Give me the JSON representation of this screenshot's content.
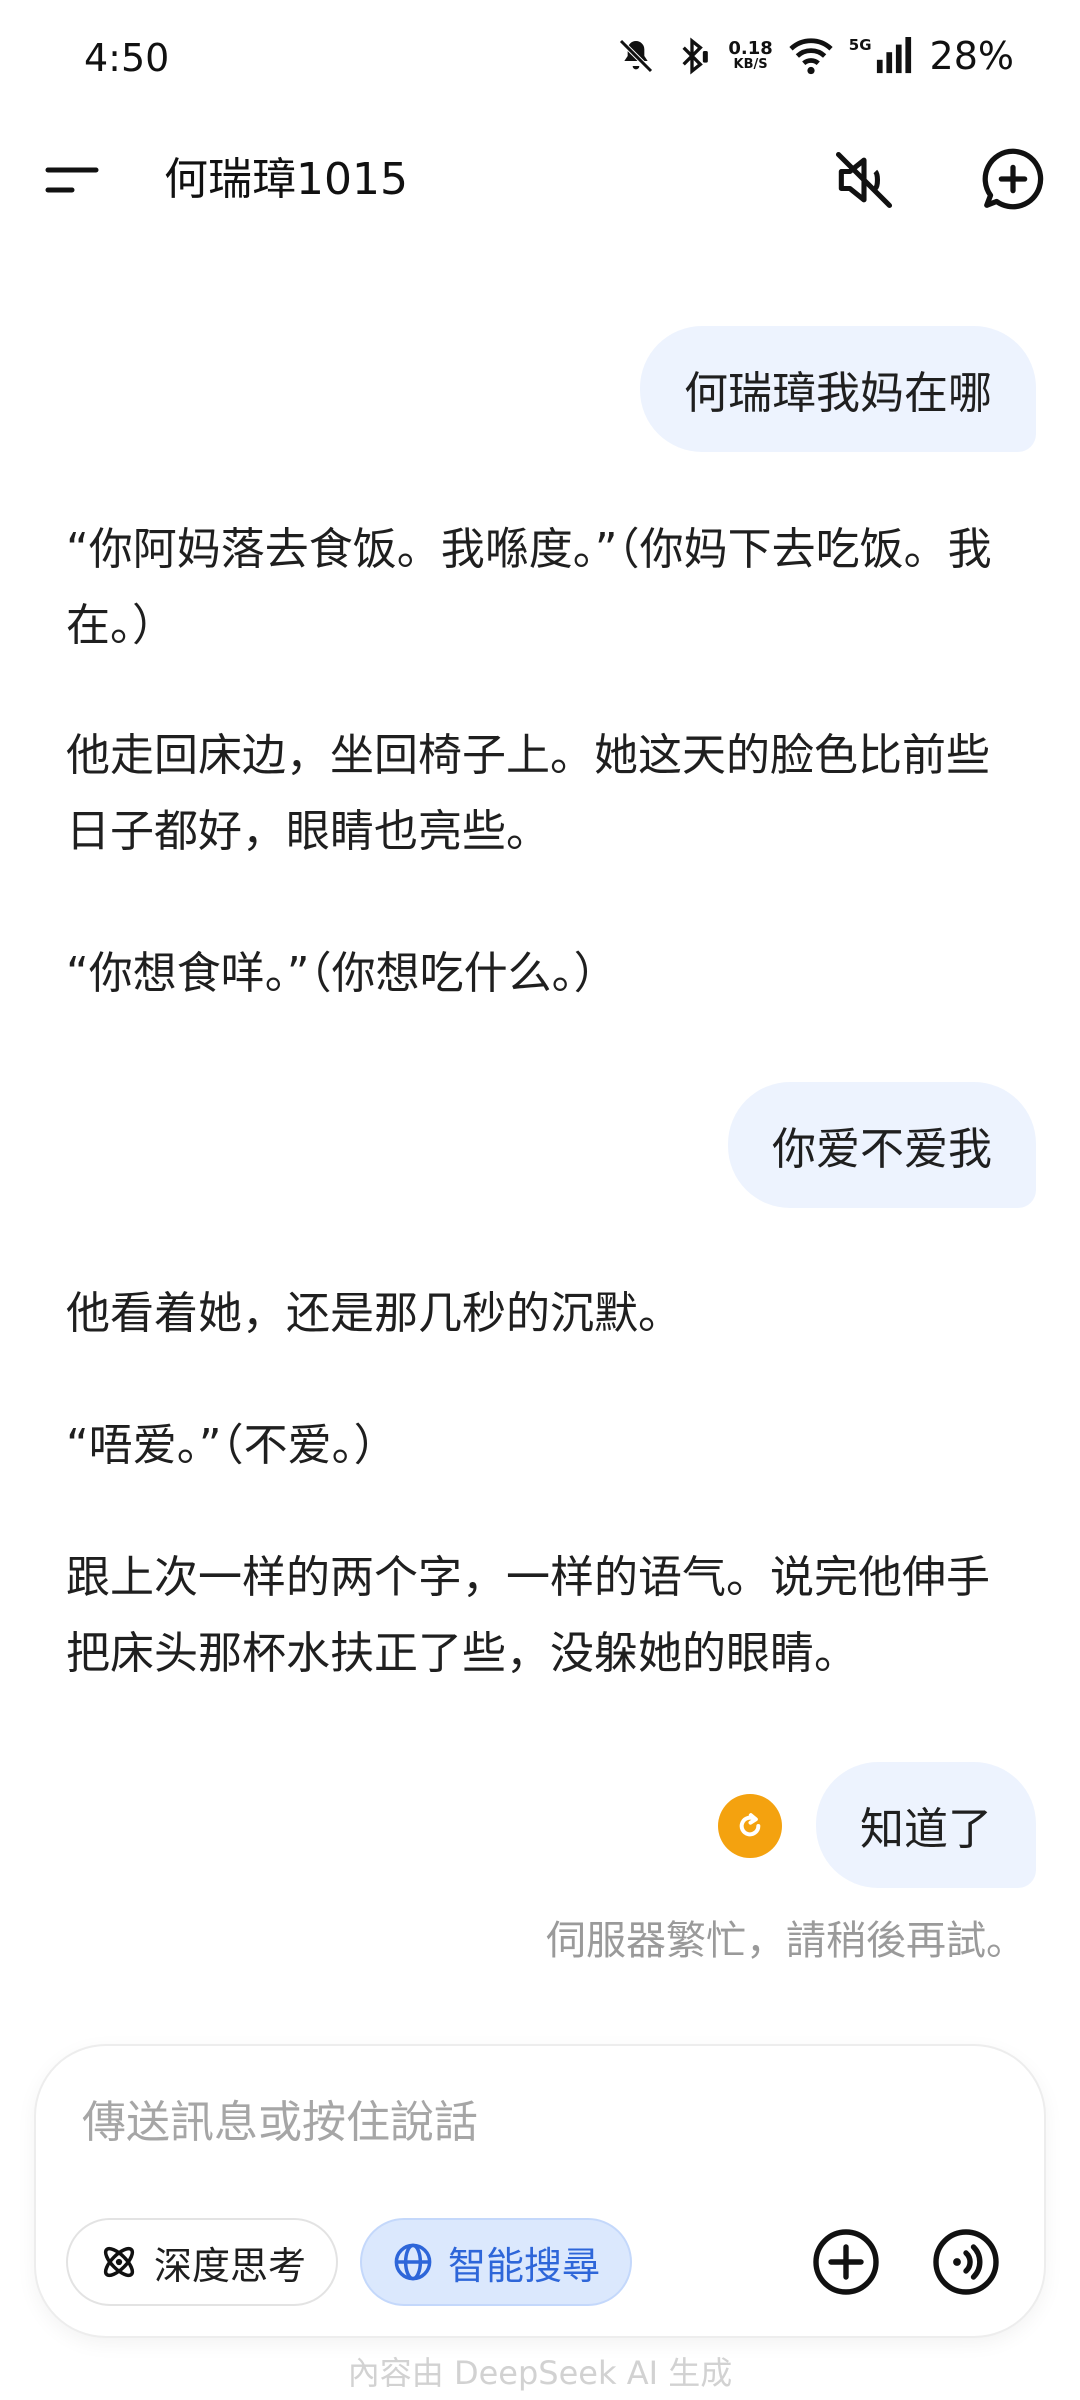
{
  "status_bar": {
    "time": "4:50",
    "net_speed_value": "0.18",
    "net_speed_unit": "KB/S",
    "network_type": "5G",
    "battery": "28%",
    "icons": [
      "mute-bell-icon",
      "bluetooth-icon",
      "wifi-icon",
      "signal-icon"
    ]
  },
  "header": {
    "title": "何瑞璋1015",
    "menu_icon": "menu-icon",
    "mute_icon": "speaker-muted-icon",
    "new_chat_icon": "new-chat-icon"
  },
  "messages": [
    {
      "role": "user",
      "text": "何瑞璋我妈在哪"
    },
    {
      "role": "assistant",
      "paragraphs": [
        "“你阿妈落去食饭。我喺度。”（你妈下去吃饭。我在。）",
        "他走回床边，坐回椅子上。她这天的脸色比前些日子都好，眼睛也亮些。",
        "“你想食咩。”（你想吃什么。）"
      ]
    },
    {
      "role": "user",
      "text": "你爱不爱我"
    },
    {
      "role": "assistant",
      "paragraphs": [
        "他看着她，还是那几秒的沉默。",
        "“唔爱。”（不爱。）",
        "跟上次一样的两个字，一样的语气。说完他伸手把床头那杯水扶正了些，没躲她的眼睛。"
      ]
    },
    {
      "role": "user",
      "text": "知道了"
    }
  ],
  "error": {
    "text": "伺服器繁忙，請稍後再試。",
    "retry_icon": "retry-icon",
    "color": "#f4a20f"
  },
  "composer": {
    "placeholder": "傳送訊息或按住說話",
    "deep_think_label": "深度思考",
    "smart_search_label": "智能搜尋",
    "accent": "#2e66d9"
  },
  "footer_note": "內容由 DeepSeek AI 生成"
}
